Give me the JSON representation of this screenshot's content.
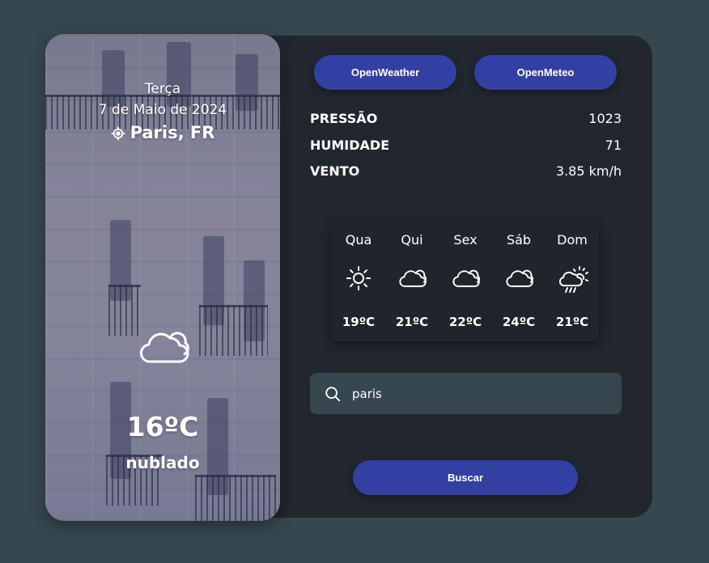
{
  "current": {
    "day_name": "Terça",
    "date": "7 de Maio de 2024",
    "location": "Paris, FR",
    "temperature": "16ºC",
    "description": "nublado",
    "icon": "cloud-icon"
  },
  "providers": {
    "openweather_label": "OpenWeather",
    "openmeteo_label": "OpenMeteo"
  },
  "stats": [
    {
      "label": "PRESSÃO",
      "value": "1023"
    },
    {
      "label": "HUMIDADE",
      "value": "71"
    },
    {
      "label": "VENTO",
      "value": "3.85 km/h"
    }
  ],
  "forecast": [
    {
      "day": "Qua",
      "temp": "19ºC",
      "icon": "sun-icon"
    },
    {
      "day": "Qui",
      "temp": "21ºC",
      "icon": "cloud-icon"
    },
    {
      "day": "Sex",
      "temp": "22ºC",
      "icon": "cloud-icon"
    },
    {
      "day": "Sáb",
      "temp": "24ºC",
      "icon": "cloud-icon"
    },
    {
      "day": "Dom",
      "temp": "21ºC",
      "icon": "sun-rain-icon"
    }
  ],
  "search": {
    "value": "paris",
    "button_label": "Buscar"
  },
  "colors": {
    "background": "#37474f",
    "card": "#22272f",
    "accent": "#3340a3",
    "input": "#37474f"
  }
}
